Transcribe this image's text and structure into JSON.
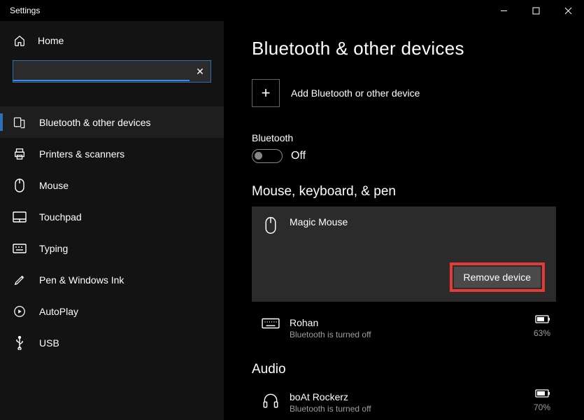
{
  "window": {
    "title": "Settings"
  },
  "sidebar": {
    "home": "Home",
    "search": {
      "value": ""
    },
    "items": [
      {
        "label": "Bluetooth & other devices"
      },
      {
        "label": "Printers & scanners"
      },
      {
        "label": "Mouse"
      },
      {
        "label": "Touchpad"
      },
      {
        "label": "Typing"
      },
      {
        "label": "Pen & Windows Ink"
      },
      {
        "label": "AutoPlay"
      },
      {
        "label": "USB"
      }
    ]
  },
  "main": {
    "title": "Bluetooth & other devices",
    "add_label": "Add Bluetooth or other device",
    "bt_label": "Bluetooth",
    "bt_state": "Off",
    "group_mkp": "Mouse, keyboard, & pen",
    "device1": {
      "name": "Magic  Mouse",
      "remove": "Remove device"
    },
    "device2": {
      "name": "Rohan",
      "status": "Bluetooth is turned off",
      "battery": "63%"
    },
    "group_audio": "Audio",
    "device3": {
      "name": "boAt Rockerz",
      "status": "Bluetooth is turned off",
      "battery": "70%"
    }
  }
}
